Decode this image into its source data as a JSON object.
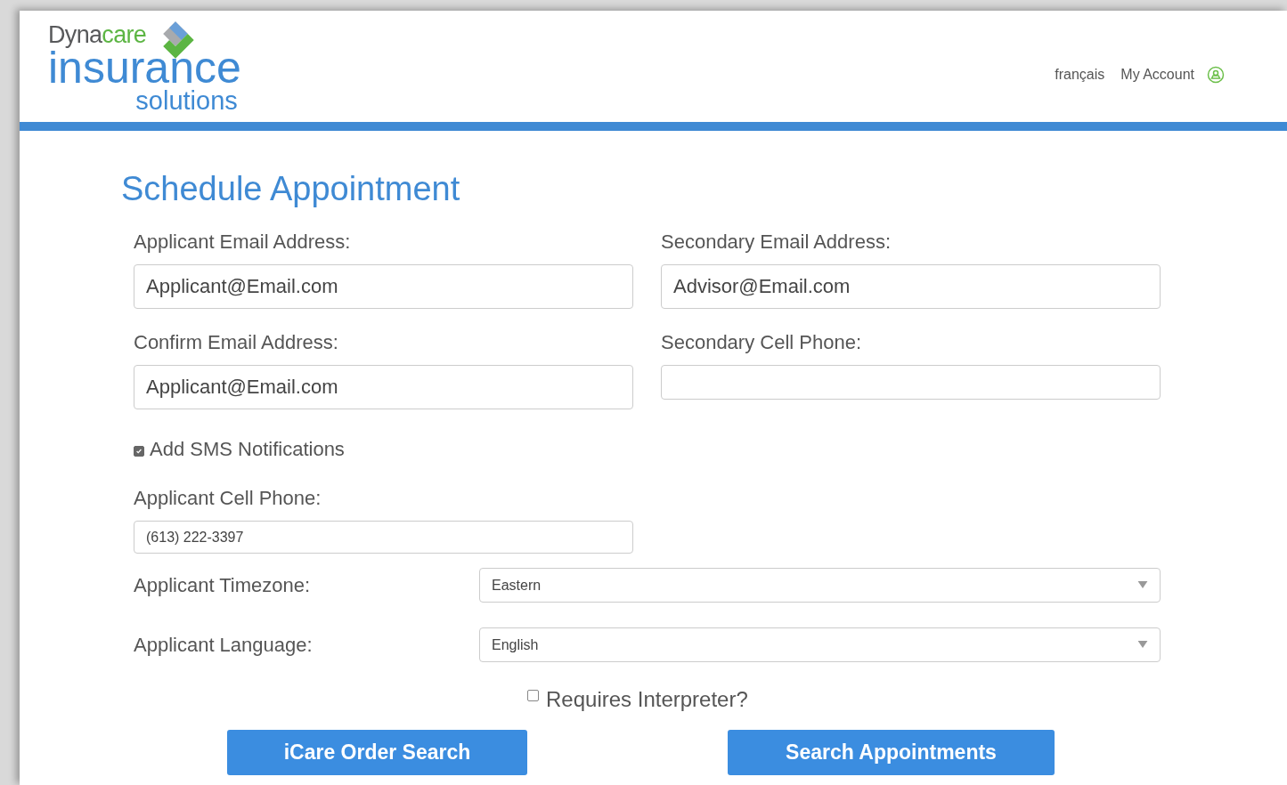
{
  "logo": {
    "wordmark": [
      {
        "text": "Dyna",
        "color": "#58595b"
      },
      {
        "text": "care",
        "color": "#5cb543"
      }
    ],
    "title": "insurance",
    "subtitle": "solutions"
  },
  "header_links": [
    {
      "label": "français",
      "kind": "link"
    },
    {
      "label": "My Account",
      "kind": "account"
    }
  ],
  "page_title": "Schedule Appointment",
  "email_fields": [
    {
      "label": "Applicant Email Address:",
      "value": "Applicant@Email.com"
    },
    {
      "label": "Secondary Email Address:",
      "value": "Advisor@Email.com"
    },
    {
      "label": "Confirm Email Address:",
      "value": "Applicant@Email.com"
    },
    {
      "label": "Secondary Cell Phone:"
    }
  ],
  "sms": {
    "label": "Add SMS Notifications",
    "checked": true
  },
  "cell_phone": {
    "label": "Applicant Cell Phone:",
    "value": "(613) 222-3397"
  },
  "selects": [
    {
      "label": "Applicant Timezone:",
      "value": "Eastern"
    },
    {
      "label": "Applicant Language:",
      "value": "English"
    }
  ],
  "interpreter": {
    "label": "Requires Interpreter?",
    "checked": false
  },
  "buttons": [
    "iCare Order Search",
    "Search Appointments"
  ]
}
